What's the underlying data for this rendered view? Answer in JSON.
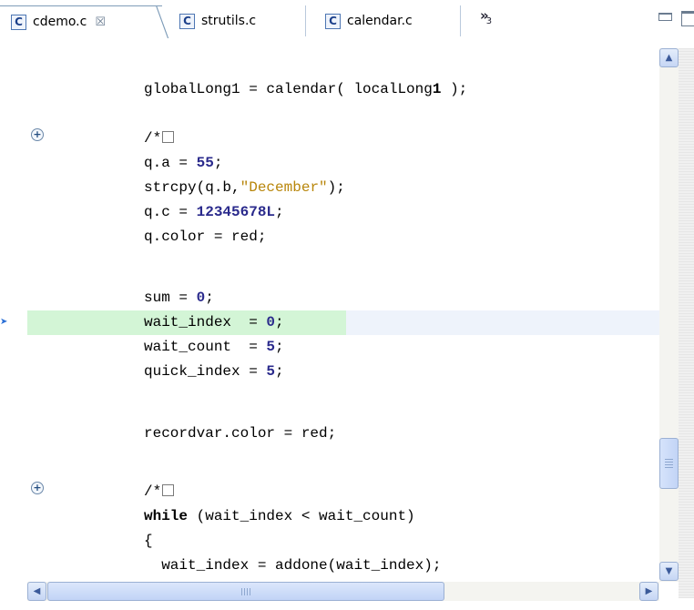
{
  "tabs": [
    {
      "label": "cdemo.c",
      "icon": "c-file-icon",
      "active": true,
      "close": "☒"
    },
    {
      "label": "strutils.c",
      "icon": "c-file-icon",
      "active": false
    },
    {
      "label": "calendar.c",
      "icon": "c-file-icon",
      "active": false
    }
  ],
  "tab_icon_glyph": "C",
  "overflow": {
    "glyph": "»",
    "count": "3"
  },
  "code_lines": [
    "globalLong1 = calendar( localLong1 );",
    "",
    "/*",
    "q.a = 55;",
    "strcpy(q.b,\"December\");",
    "q.c = 12345678L;",
    "q.color = red;",
    "",
    "sum = 0;",
    "wait_index  = 0;",
    "wait_count  = 5;",
    "quick_index = 5;",
    "",
    "recordvar.color = red;",
    "",
    "/*",
    "while (wait_index < wait_count)",
    "{",
    "  wait_index = addone(wait_index);"
  ],
  "colors": {
    "current_line": "#eef3fb",
    "instruction_pointer_line": "#d3f5d6",
    "number": "#2a2a8c",
    "string": "#b8860b"
  },
  "gutter": {
    "expand_glyph": "+",
    "instruction_pointer_glyph": "➤"
  }
}
